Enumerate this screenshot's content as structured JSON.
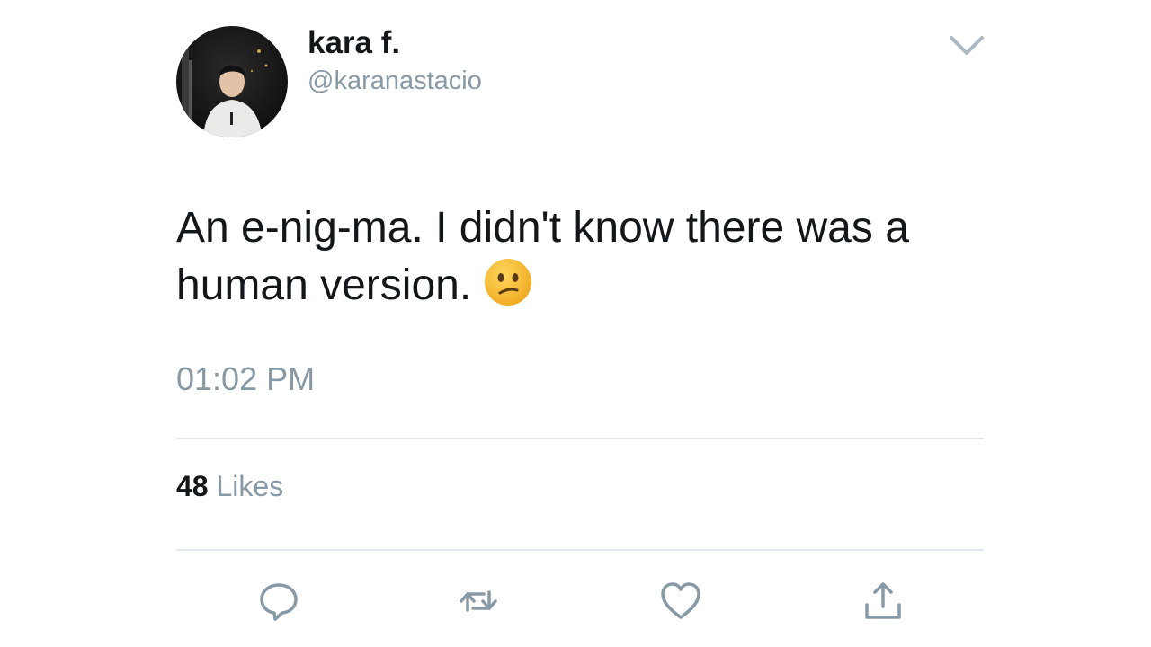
{
  "tweet": {
    "author": {
      "display_name": "kara f.",
      "handle": "@karanastacio"
    },
    "text": "An e-nig-ma. I didn't know there was a human version.",
    "emoji_icon": "confused-face-icon",
    "timestamp": "01:02 PM",
    "likes": {
      "count": "48",
      "label": "Likes"
    }
  },
  "actions": [
    {
      "icon": "reply-icon"
    },
    {
      "icon": "retweet-icon"
    },
    {
      "icon": "like-heart-icon"
    },
    {
      "icon": "share-icon"
    }
  ],
  "colors": {
    "text_primary": "#14171a",
    "text_secondary": "#8899a6",
    "divider": "#e1e8ed",
    "icon": "#8899a6",
    "emoji_face": "#f7c02a"
  }
}
